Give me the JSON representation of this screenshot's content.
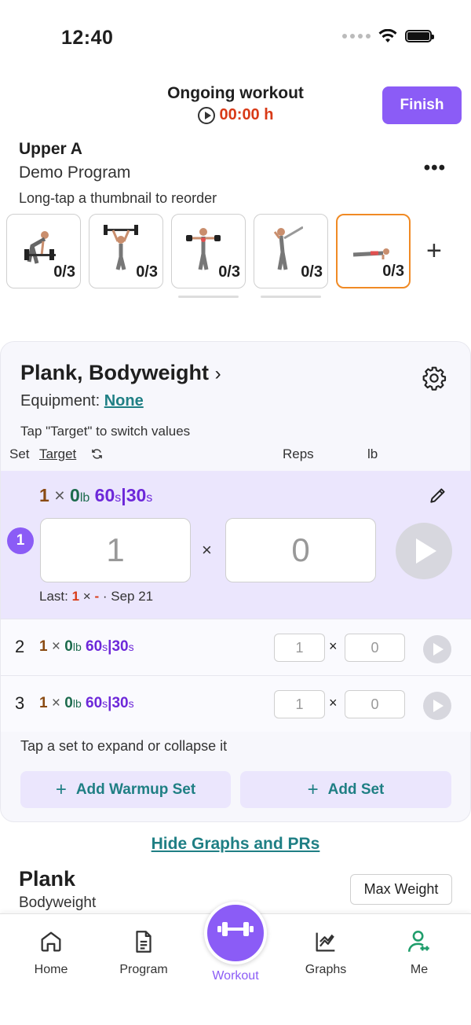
{
  "status_bar": {
    "time": "12:40"
  },
  "header": {
    "title": "Ongoing workout",
    "timer": "00:00 h",
    "finish_label": "Finish"
  },
  "program": {
    "name": "Upper A",
    "subtitle": "Demo Program",
    "hint": "Long-tap a thumbnail to reorder"
  },
  "thumbnails": [
    {
      "count": "0/3"
    },
    {
      "count": "0/3"
    },
    {
      "count": "0/3"
    },
    {
      "count": "0/3"
    },
    {
      "count": "0/3"
    }
  ],
  "exercise": {
    "title": "Plank, Bodyweight",
    "equipment_label": "Equipment:",
    "equipment_value": "None",
    "target_hint": "Tap \"Target\" to switch values",
    "columns": {
      "set": "Set",
      "target": "Target",
      "reps": "Reps",
      "weight": "lb"
    }
  },
  "active_set": {
    "number": "1",
    "reps": "1",
    "times": "×",
    "weight": "0",
    "weight_unit": "lb",
    "work": "60",
    "work_unit": "s",
    "sep": "|",
    "rest": "30",
    "rest_unit": "s",
    "reps_value": "1",
    "weight_value": "0",
    "last_label": "Last:",
    "last_reps": "1",
    "last_times": "×",
    "last_dash": "-",
    "last_date": "· Sep 21"
  },
  "sets": [
    {
      "number": "2",
      "reps": "1",
      "weight": "0",
      "work": "60",
      "rest": "30",
      "reps_value": "1",
      "weight_value": "0"
    },
    {
      "number": "3",
      "reps": "1",
      "weight": "0",
      "work": "60",
      "rest": "30",
      "reps_value": "1",
      "weight_value": "0"
    }
  ],
  "set_hint": "Tap a set to expand or collapse it",
  "buttons": {
    "add_warmup": "Add Warmup Set",
    "add_set": "Add Set",
    "plus": "+"
  },
  "graphs": {
    "toggle": "Hide Graphs and PRs",
    "title": "Plank",
    "subtitle": "Bodyweight",
    "metric": "Max Weight"
  },
  "tabs": [
    {
      "label": "Home",
      "icon": "home-icon"
    },
    {
      "label": "Program",
      "icon": "document-icon"
    },
    {
      "label": "Workout",
      "icon": "dumbbell-icon"
    },
    {
      "label": "Graphs",
      "icon": "chart-icon"
    },
    {
      "label": "Me",
      "icon": "profile-icon"
    }
  ],
  "colors": {
    "accent": "#8b5cf6",
    "teal": "#1f7f84",
    "timer_red": "#d83a17",
    "active_orange": "#f08a24"
  }
}
